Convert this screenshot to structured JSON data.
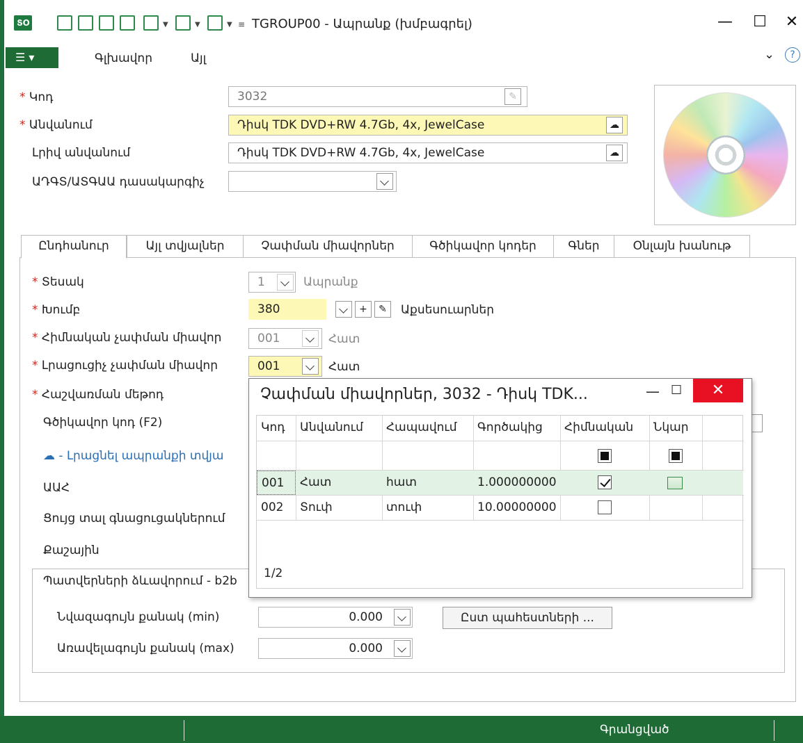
{
  "window": {
    "title": "TGROUP00 - Ապրանք (խմբագրել)",
    "app_icon_text": "ՏՕ",
    "minimize": "—",
    "maximize": "☐",
    "close": "✕"
  },
  "menu": {
    "main_menu_icon": "list-icon",
    "items": [
      "Գլխավոր",
      "Այլ"
    ],
    "collapse_glyph": "⌄",
    "help_glyph": "?"
  },
  "form": {
    "code_label": "Կոդ",
    "code_value": "3032",
    "name_label": "Անվանում",
    "name_value": "Դիսկ TDK DVD+RW 4.7Gb, 4x, JewelCase",
    "fullname_label": "Լրիվ անվանում",
    "fullname_value": "Դիսկ TDK DVD+RW 4.7Gb, 4x, JewelCase",
    "classifier_label": "ԱԴԳՏ/ԱՏԳԱԱ դասակարգիչ",
    "classifier_value": "",
    "required_mark": "*"
  },
  "tabs": [
    "Ընդհանուր",
    "Այլ տվյալներ",
    "Չափման միավորներ",
    "Գծիկավոր կոդեր",
    "Գներ",
    "Օնլայն խանութ"
  ],
  "general": {
    "type_label": "Տեսակ",
    "type_code": "1",
    "type_name": "Ապրանք",
    "group_label": "Խումբ",
    "group_code": "380",
    "group_name": "Աքսեսուարներ",
    "base_unit_label": "Հիմնական չափման միավոր",
    "base_unit_code": "001",
    "base_unit_name": "Հատ",
    "extra_unit_label": "Լրացուցիչ չափման միավոր",
    "extra_unit_code": "001",
    "extra_unit_name": "Հատ",
    "calc_method_label": "Հաշվառման մեթոդ",
    "barcode_label": "Գծիկավոր կոդ (F2)",
    "fill_link": "- Լրացնել ապրանքի տվյա",
    "vat_label": "ԱԱՀ",
    "show_in_lists_label": "Ցույց տալ գնացուցակներում",
    "weight_label": "Քաշային",
    "group_box_title": "Պատվերների ձևավորում - b2b",
    "min_qty_label": "Նվազագույն քանակ (min)",
    "min_qty_value": "0.000",
    "max_qty_label": "Առավելագույն քանակ (max)",
    "max_qty_value": "0.000",
    "by_stock_button": "Ըստ պահեստների ..."
  },
  "popup": {
    "title": "Չափման միավորներ, 3032 - Դիսկ TDK...",
    "minimize": "—",
    "maximize": "☐",
    "close": "✕",
    "columns": [
      "Կոդ",
      "Անվանում",
      "Հապավում",
      "Գործակից",
      "Հիմնական",
      "Նկար"
    ],
    "rows": [
      {
        "code": "001",
        "name": "Հատ",
        "abbr": "հատ",
        "factor": "1.000000000",
        "base": true,
        "has_pic": true
      },
      {
        "code": "002",
        "name": "Տուփ",
        "abbr": "տուփ",
        "factor": "10.00000000",
        "base": false,
        "has_pic": false
      }
    ],
    "pager": "1/2"
  },
  "status": {
    "text": "Գրանցված"
  },
  "colors": {
    "accent_green": "#1e6b35",
    "required_red": "#d0271d",
    "highlight_yellow": "#fdf8b6",
    "close_red": "#e81123"
  }
}
